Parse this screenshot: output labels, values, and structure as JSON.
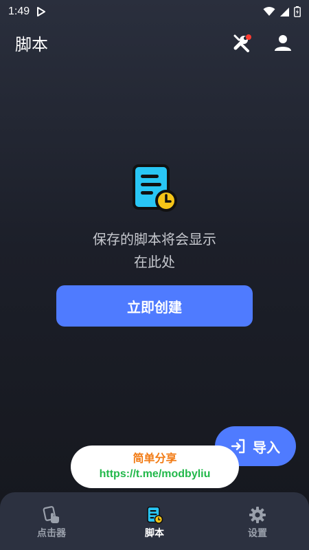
{
  "status_bar": {
    "time": "1:49"
  },
  "app_bar": {
    "title": "脚本"
  },
  "empty_state": {
    "message_line1": "保存的脚本将会显示",
    "message_line2": "在此处"
  },
  "actions": {
    "create_label": "立即创建",
    "import_label": "导入"
  },
  "share_banner": {
    "title": "简单分享",
    "link": "https://t.me/modbyliu"
  },
  "bottom_nav": {
    "items": [
      {
        "label": "点击器",
        "icon": "clicker-icon",
        "active": false
      },
      {
        "label": "脚本",
        "icon": "script-icon",
        "active": true
      },
      {
        "label": "设置",
        "icon": "gear-icon",
        "active": false
      }
    ]
  },
  "colors": {
    "accent": "#4f7bff",
    "illustration": "#29c6f4",
    "clock": "#f5c518",
    "badge": "#ff3b30",
    "share_title": "#f27b14",
    "share_link": "#22b84a"
  }
}
